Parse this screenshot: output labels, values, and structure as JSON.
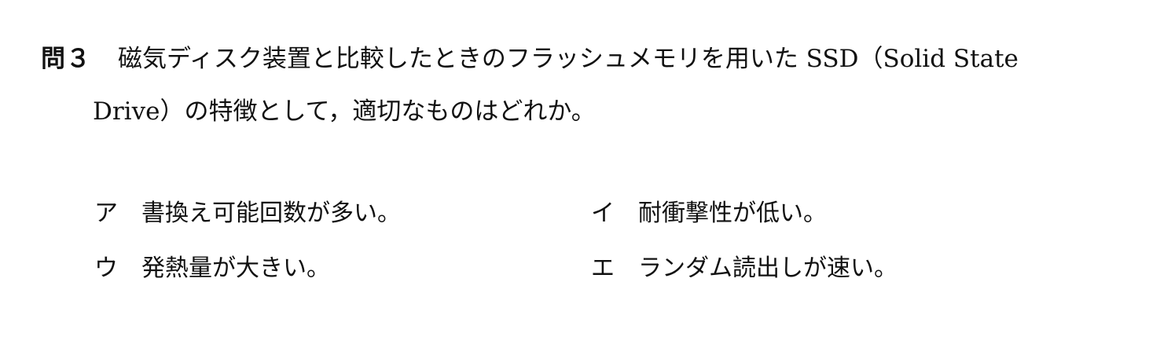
{
  "question": {
    "number": "問３",
    "text_line1": "磁気ディスク装置と比較したときのフラッシュメモリを用いた SSD（Solid State",
    "text_line2": "Drive）の特徴として，適切なものはどれか。"
  },
  "choices": [
    {
      "label": "ア",
      "text": "書換え可能回数が多い。"
    },
    {
      "label": "イ",
      "text": "耐衝撃性が低い。"
    },
    {
      "label": "ウ",
      "text": "発熱量が大きい。"
    },
    {
      "label": "エ",
      "text": "ランダム読出しが速い。"
    }
  ]
}
